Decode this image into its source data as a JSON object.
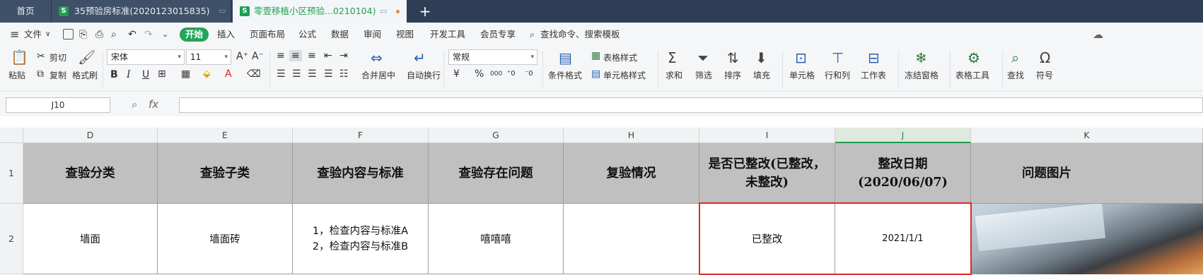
{
  "tabs": {
    "home": "首页",
    "tab1": "35预验房标准(2020123015835)",
    "tab2": "零壹移植小区预验...0210104)"
  },
  "menu": {
    "file": "文件",
    "items": [
      "开始",
      "插入",
      "页面布局",
      "公式",
      "数据",
      "审阅",
      "视图",
      "开发工具",
      "会员专享"
    ],
    "search": "查找命令、搜索模板"
  },
  "ribbon": {
    "paste": "粘贴",
    "cut": "剪切",
    "copy": "复制",
    "format_painter": "格式刷",
    "font_name": "宋体",
    "font_size": "11",
    "bold": "B",
    "italic": "I",
    "underline": "U",
    "merge_center": "合并居中",
    "wrap_text": "自动换行",
    "number_format": "常规",
    "currency": "¥",
    "percent": "%",
    "thousands": "000",
    "conditional_format": "条件格式",
    "table_style": "表格样式",
    "cell_style": "单元格样式",
    "sum": "求和",
    "filter": "筛选",
    "sort": "排序",
    "fill": "填充",
    "cells": "单元格",
    "rows_cols": "行和列",
    "worksheet": "工作表",
    "freeze": "冻结窗格",
    "table_tools": "表格工具",
    "find": "查找",
    "symbol": "符号"
  },
  "formula_bar": {
    "name_box": "J10",
    "formula": ""
  },
  "columns": [
    "D",
    "E",
    "F",
    "G",
    "H",
    "I",
    "J",
    "K"
  ],
  "rows": [
    "1",
    "2"
  ],
  "header_row": [
    "查验分类",
    "查验子类",
    "查验内容与标准",
    "查验存在问题",
    "复验情况",
    "是否已整改(已整改，未整改)",
    "整改日期(2020/06/07)",
    "问题图片"
  ],
  "data_row": {
    "D": "墙面",
    "E": "墙面砖",
    "F": [
      "1，检查内容与标准A",
      "2，检查内容与标准B"
    ],
    "G": "嘻嘻嘻",
    "H": "",
    "I": "已整改",
    "J": "2021/1/1"
  },
  "colors": {
    "accent": "#25a45b",
    "header_fill": "#c0c0c0",
    "selection": "#e02a2a"
  }
}
